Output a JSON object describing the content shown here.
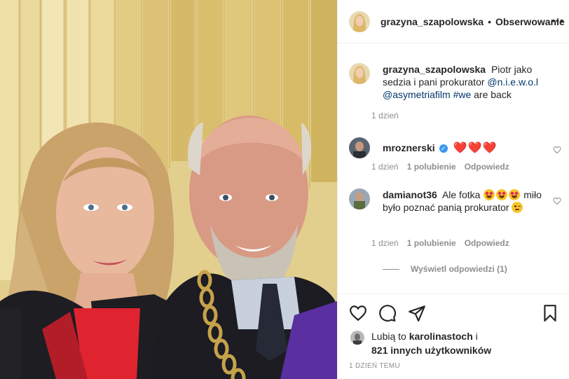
{
  "post": {
    "author": "grazyna_szapolowska",
    "separator": "•",
    "follow_label": "Obserwowanie",
    "more_label": "•••"
  },
  "caption": {
    "user": "grazyna_szapolowska",
    "text": "Piotr jako sedzia i pani prokurator",
    "mention1": "@n.i.e.w.o.l",
    "mention2": "@asymetriafilm",
    "hashtag": "#we",
    "text_end": "are back",
    "time": "1 dzień"
  },
  "comments": [
    {
      "user": "mroznerski",
      "verified_mark": "✓",
      "text": "❤️❤️❤️",
      "time": "1 dzień",
      "likes": "1 polubienie",
      "reply": "Odpowiedz"
    },
    {
      "user": "damianot36",
      "text1": "Ale fotka",
      "text2": "miło było poznać panią prokurator",
      "time": "1 dzień",
      "likes": "1 polubienie",
      "reply": "Odpowiedz"
    }
  ],
  "view_replies": "Wyświetl odpowiedzi (1)",
  "likes_summary": {
    "prefix": "Lubią to",
    "user": "karolinastoch",
    "conj": "i",
    "others": "821 innych użytkowników"
  },
  "time_ago": "1 dzień temu",
  "icons": [
    "heart-icon",
    "comment-icon",
    "share-icon",
    "bookmark-icon",
    "more-icon",
    "verified-icon"
  ],
  "colors": {
    "link": "#00376b",
    "meta": "#8e8e8e",
    "verified": "#3897f0",
    "heart": "#ed4956"
  }
}
